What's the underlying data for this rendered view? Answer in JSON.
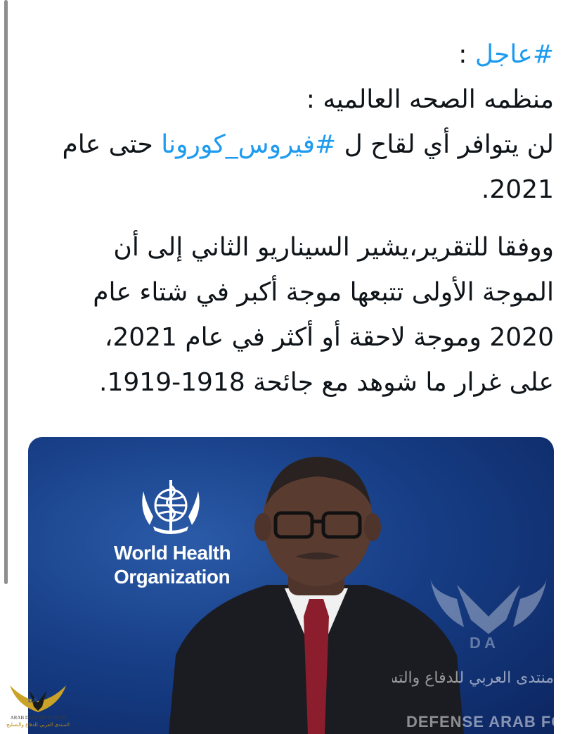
{
  "tweet": {
    "paragraph1": {
      "line1_hashtag": "#عاجل",
      "line1_rest": " :",
      "line2": "منظمه الصحه العالميه :",
      "line3_start": "لن يتوافر أي لقاح ل ",
      "line3_hashtag": "#فيروس_كورونا",
      "line3_end": " حتى عام",
      "line4": "2021."
    },
    "paragraph2": {
      "line1": "ووفقا للتقرير،يشير السيناريو الثاني إلى أن",
      "line2": "الموجة الأولى تتبعها موجة أكبر في شتاء عام",
      "line3": "2020 وموجة لاحقة أو أكثر في عام 2021،",
      "line4": "على غرار ما شوهد مع جائحة 1918-1919."
    }
  },
  "media": {
    "org_name_line1": "World Health",
    "org_name_line2": "Organization",
    "watermark_arabic": "منتدى العربي للدفاع والتسليح",
    "watermark_english": "DEFENSE ARAB FORUM"
  },
  "forum_badge": {
    "text_en": "ARAB DEFENSE FORUM",
    "text_ar": "المنتدى العربي للدفاع والتسليح"
  },
  "colors": {
    "hashtag": "#1d9bf0",
    "text": "#0f1419",
    "media_bg": "#173e86"
  }
}
